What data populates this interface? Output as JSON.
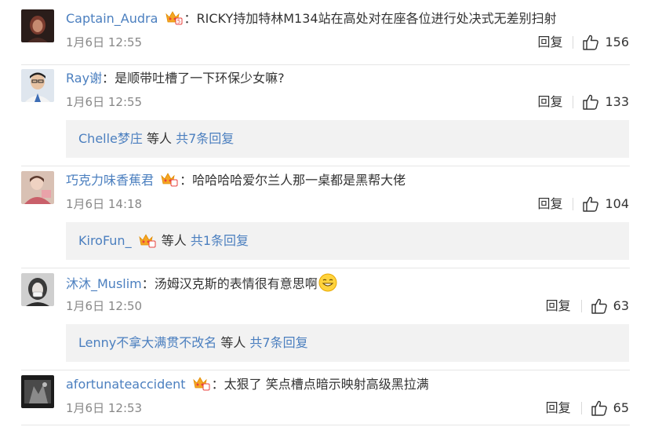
{
  "comments": [
    {
      "username": "Captain_Audra",
      "colon": "：",
      "text": "RICKY持加特林M134站在高处对在座各位进行处决式无差别扫射",
      "time": "1月6日 12:55",
      "reply_label": "回复",
      "likes": "156"
    },
    {
      "username": "Ray谢",
      "colon": "：",
      "text": "是顺带吐槽了一下环保少女嘛?",
      "time": "1月6日 12:55",
      "reply_label": "回复",
      "likes": "133",
      "replies": {
        "user": "Chelle梦庄",
        "mid": " 等人 ",
        "total": "共7条回复"
      }
    },
    {
      "username": "巧克力味香蕉君",
      "colon": "：",
      "text": "哈哈哈哈爱尔兰人那一桌都是黑帮大佬",
      "time": "1月6日 14:18",
      "reply_label": "回复",
      "likes": "104",
      "replies": {
        "user": "KiroFun_",
        "mid": " 等人 ",
        "total": "共1条回复"
      }
    },
    {
      "username": "沐沐_Muslim",
      "colon": "：",
      "text": "汤姆汉克斯的表情很有意思啊",
      "time": "1月6日 12:50",
      "reply_label": "回复",
      "likes": "63",
      "replies": {
        "user": "Lenny不拿大满贯不改名",
        "mid": " 等人 ",
        "total": "共7条回复"
      }
    },
    {
      "username": "afortunateaccident",
      "colon": "：",
      "text": "太狠了 笑点槽点暗示映射高级黑拉满",
      "time": "1月6日 12:53",
      "reply_label": "回复",
      "likes": "65"
    }
  ],
  "colors": {
    "username": "#4b7fbf",
    "text": "#333333",
    "meta": "#888888",
    "reply_bg": "#f2f2f2",
    "divider": "#e6e6e6"
  },
  "icons": {
    "badge": "vip-crown-badge-icon",
    "like": "thumbs-up-icon",
    "emoji": "grin-emoji-icon"
  }
}
